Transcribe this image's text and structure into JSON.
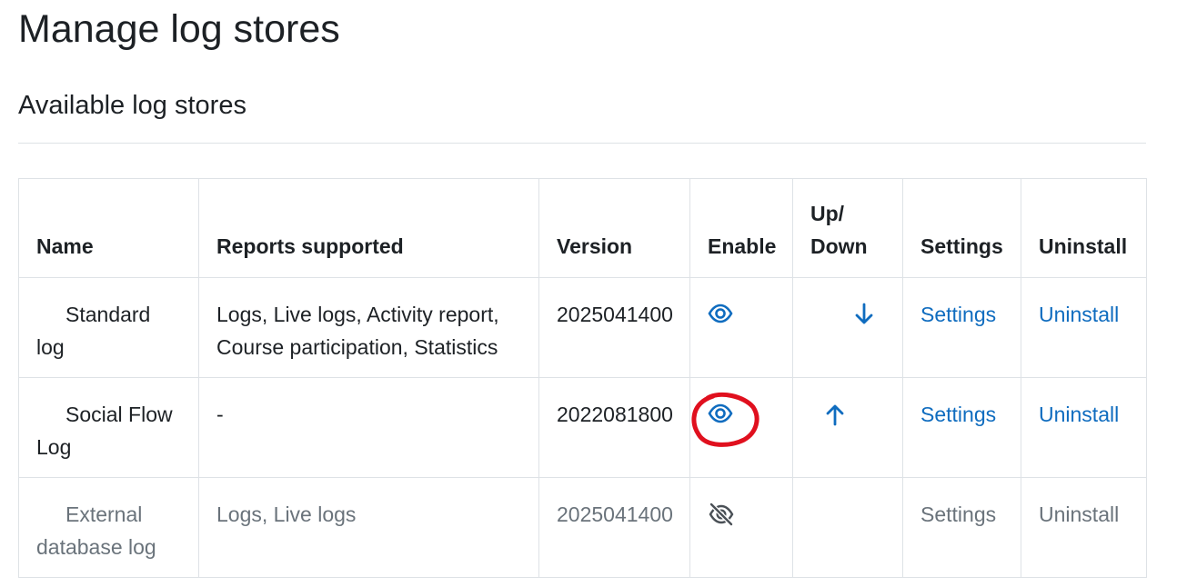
{
  "page": {
    "title": "Manage log stores",
    "section_title": "Available log stores"
  },
  "table": {
    "headers": {
      "name": "Name",
      "reports": "Reports supported",
      "version": "Version",
      "enable": "Enable",
      "updown_1": "Up/",
      "updown_2": "Down",
      "settings": "Settings",
      "uninstall": "Uninstall"
    },
    "rows": [
      {
        "name_1": "Standard",
        "name_2": "log",
        "reports_1": "Logs, Live logs, Activity report,",
        "reports_2": "Course participation, Statistics",
        "version": "2025041400",
        "enable_icon": "eye-icon",
        "move_icon": "arrow-down-icon",
        "settings": "Settings",
        "uninstall": "Uninstall",
        "enabled": true
      },
      {
        "name_1": "Social Flow",
        "name_2": "Log",
        "reports_1": "-",
        "reports_2": "",
        "version": "2022081800",
        "enable_icon": "eye-icon",
        "move_icon": "arrow-up-icon",
        "settings": "Settings",
        "uninstall": "Uninstall",
        "enabled": true
      },
      {
        "name_1": "External",
        "name_2": "database log",
        "reports_1": "Logs, Live logs",
        "reports_2": "",
        "version": "2025041400",
        "enable_icon": "eye-slash-icon",
        "move_icon": "",
        "settings": "Settings",
        "uninstall": "Uninstall",
        "enabled": false
      }
    ]
  },
  "colors": {
    "link": "#0f6cbf",
    "muted": "#6a737b",
    "text": "#1d2125",
    "border": "#dee2e6",
    "annotation": "#e0101e"
  }
}
